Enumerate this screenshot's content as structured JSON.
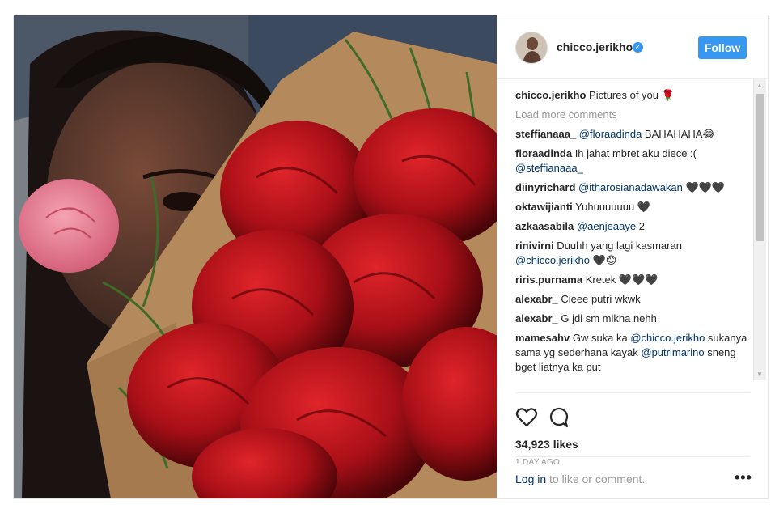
{
  "post": {
    "username": "chicco.jerikho",
    "follow_label": "Follow",
    "load_more": "Load more comments",
    "likes": "34,923 likes",
    "time": "1 DAY AGO",
    "login_link": "Log in",
    "login_rest": " to like or comment.",
    "more_label": "•••"
  },
  "caption": {
    "user": "chicco.jerikho",
    "text": " Pictures of you 🌹"
  },
  "comments": [
    {
      "user": "steffianaaa_",
      "parts": [
        {
          "t": " "
        },
        {
          "m": "@floraadinda"
        },
        {
          "t": " BAHAHAHA😂"
        }
      ]
    },
    {
      "user": "floraadinda",
      "parts": [
        {
          "t": " Ih jahat mbret aku diece :( "
        },
        {
          "m": "@steffianaaa_"
        }
      ]
    },
    {
      "user": "diinyrichard",
      "parts": [
        {
          "t": " "
        },
        {
          "m": "@itharosianadawakan"
        },
        {
          "t": " 🖤🖤🖤"
        }
      ]
    },
    {
      "user": "oktawijianti",
      "parts": [
        {
          "t": " Yuhuuuuuuu 🖤"
        }
      ]
    },
    {
      "user": "azkaasabila",
      "parts": [
        {
          "t": " "
        },
        {
          "m": "@aenjeaaye"
        },
        {
          "t": " 2"
        }
      ]
    },
    {
      "user": "rinivirni",
      "parts": [
        {
          "t": " Duuhh yang lagi kasmaran "
        },
        {
          "m": "@chicco.jerikho"
        },
        {
          "t": " 🖤😊"
        }
      ]
    },
    {
      "user": "riris.purnama",
      "parts": [
        {
          "t": " Kretek 🖤🖤🖤"
        }
      ]
    },
    {
      "user": "alexabr_",
      "parts": [
        {
          "t": " Cieee putri wkwk"
        }
      ]
    },
    {
      "user": "alexabr_",
      "parts": [
        {
          "t": " G jdi sm mikha nehh"
        }
      ]
    },
    {
      "user": "mamesahv",
      "parts": [
        {
          "t": " Gw suka ka "
        },
        {
          "m": "@chicco.jerikho"
        },
        {
          "t": " sukanya sama yg sederhana kayak "
        },
        {
          "m": "@putrimarino"
        },
        {
          "t": " sneng bget liatnya ka put"
        }
      ]
    }
  ],
  "colors": {
    "accent": "#3897f0",
    "rose": "#b3141b",
    "mention": "#003569"
  },
  "icons": [
    "verified-badge-icon",
    "heart-icon",
    "comment-bubble-icon"
  ]
}
